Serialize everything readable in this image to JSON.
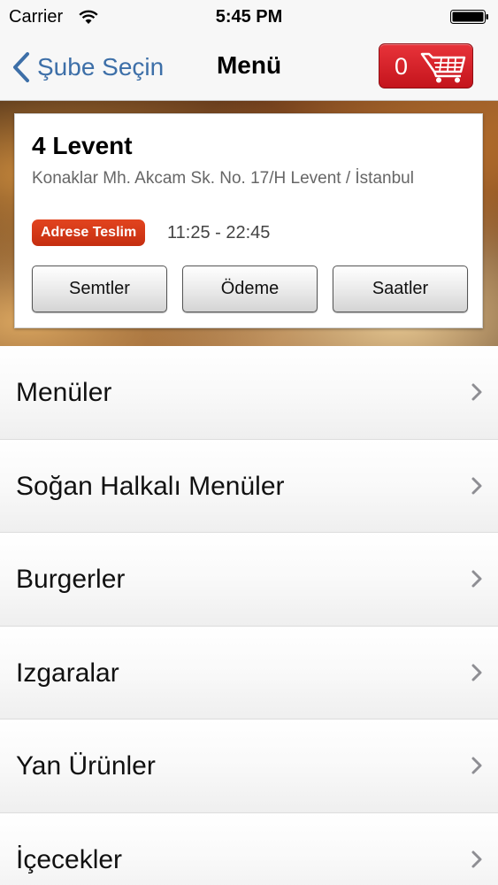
{
  "status_bar": {
    "carrier": "Carrier",
    "time": "5:45 PM",
    "icons": [
      "wifi-icon",
      "battery-icon"
    ]
  },
  "nav": {
    "back_label": "Şube Seçin",
    "title": "Menü",
    "cart_count": "0",
    "cart_icon": "shopping-cart-icon",
    "cart_color": "#d11f26",
    "back_color": "#3d6fa8"
  },
  "branch": {
    "name": "4 Levent",
    "address": "Konaklar Mh. Akcam Sk. No. 17/H Levent / İstanbul",
    "badge": "Adrese Teslim",
    "badge_color": "#d63a18",
    "hours": "11:25 - 22:45",
    "buttons": {
      "districts": "Semtler",
      "payment": "Ödeme",
      "hours": "Saatler"
    }
  },
  "menu": {
    "items": [
      {
        "label": "Menüler"
      },
      {
        "label": "Soğan Halkalı Menüler"
      },
      {
        "label": "Burgerler"
      },
      {
        "label": "Izgaralar"
      },
      {
        "label": "Yan Ürünler"
      },
      {
        "label": "İçecekler"
      }
    ]
  }
}
